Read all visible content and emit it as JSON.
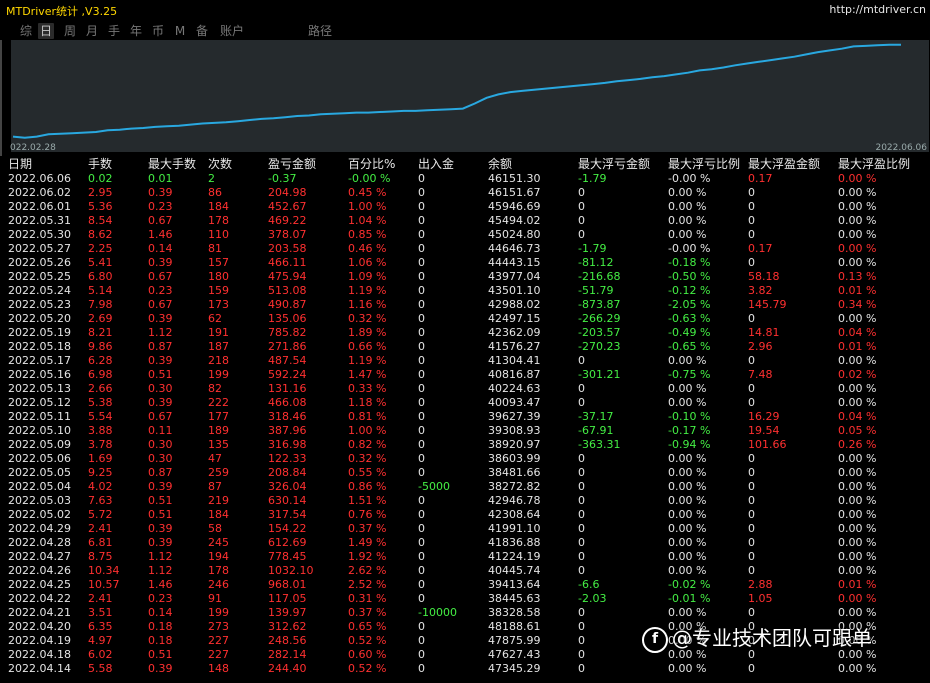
{
  "app": {
    "title": "MTDriver统计 ,V3.25",
    "url": "http://mtdriver.cn"
  },
  "menu": [
    {
      "label": "综",
      "active": false
    },
    {
      "label": "日",
      "active": true
    },
    {
      "label": "周",
      "active": false
    },
    {
      "label": "月",
      "active": false
    },
    {
      "label": "手",
      "active": false
    },
    {
      "label": "年",
      "active": false
    },
    {
      "label": "币",
      "active": false
    },
    {
      "label": "M",
      "active": false
    },
    {
      "label": "备",
      "active": false
    },
    {
      "label": "账户",
      "active": false
    },
    {
      "label": "路径",
      "active": false
    }
  ],
  "chart": {
    "start_date": "022.02.28",
    "end_date": "2022.06.06",
    "line_color": "#29a8e0"
  },
  "chart_data": {
    "type": "line",
    "series": [
      {
        "values": [
          38100,
          38000,
          38100,
          38300,
          38350,
          38400,
          38450,
          38500,
          38650,
          38700,
          38800,
          38850,
          38950,
          39000,
          39050,
          39150,
          39250,
          39300,
          39350,
          39450,
          39550,
          39650,
          39700,
          39800,
          39900,
          39950,
          40050,
          40100,
          40150,
          40200,
          40200,
          40250,
          40300,
          40350,
          40350,
          40400,
          40450,
          40500,
          40550,
          41000,
          41500,
          41800,
          42000,
          42100,
          42200,
          42300,
          42400,
          42500,
          42600,
          42700,
          42800,
          42950,
          43050,
          43150,
          43300,
          43400,
          43550,
          43700,
          43900,
          44000,
          44150,
          44350,
          44500,
          44650,
          44800,
          44950,
          45100,
          45300,
          45500,
          45650,
          45800,
          46000,
          46050,
          46100,
          46150,
          46152
        ]
      }
    ],
    "ylim": [
      37800,
      46300
    ],
    "grid": false
  },
  "table": {
    "headers": [
      "日期",
      "手数",
      "最大手数",
      "次数",
      "盈亏金额",
      "百分比%",
      "出入金",
      "余额",
      "最大浮亏金额",
      "最大浮亏比例",
      "最大浮盈金额",
      "最大浮盈比例"
    ],
    "rows": [
      [
        "2022.06.06",
        "0.02",
        "0.01",
        "2",
        "-0.37",
        "-0.00 %",
        "0",
        "46151.30",
        "-1.79",
        "-0.00 %",
        "0.17",
        "0.00 %"
      ],
      [
        "2022.06.02",
        "2.95",
        "0.39",
        "86",
        "204.98",
        "0.45 %",
        "0",
        "46151.67",
        "0",
        "0.00 %",
        "0",
        "0.00 %"
      ],
      [
        "2022.06.01",
        "5.36",
        "0.23",
        "184",
        "452.67",
        "1.00 %",
        "0",
        "45946.69",
        "0",
        "0.00 %",
        "0",
        "0.00 %"
      ],
      [
        "2022.05.31",
        "8.54",
        "0.67",
        "178",
        "469.22",
        "1.04 %",
        "0",
        "45494.02",
        "0",
        "0.00 %",
        "0",
        "0.00 %"
      ],
      [
        "2022.05.30",
        "8.62",
        "1.46",
        "110",
        "378.07",
        "0.85 %",
        "0",
        "45024.80",
        "0",
        "0.00 %",
        "0",
        "0.00 %"
      ],
      [
        "2022.05.27",
        "2.25",
        "0.14",
        "81",
        "203.58",
        "0.46 %",
        "0",
        "44646.73",
        "-1.79",
        "-0.00 %",
        "0.17",
        "0.00 %"
      ],
      [
        "2022.05.26",
        "5.41",
        "0.39",
        "157",
        "466.11",
        "1.06 %",
        "0",
        "44443.15",
        "-81.12",
        "-0.18 %",
        "0",
        "0.00 %"
      ],
      [
        "2022.05.25",
        "6.80",
        "0.67",
        "180",
        "475.94",
        "1.09 %",
        "0",
        "43977.04",
        "-216.68",
        "-0.50 %",
        "58.18",
        "0.13 %"
      ],
      [
        "2022.05.24",
        "5.14",
        "0.23",
        "159",
        "513.08",
        "1.19 %",
        "0",
        "43501.10",
        "-51.79",
        "-0.12 %",
        "3.82",
        "0.01 %"
      ],
      [
        "2022.05.23",
        "7.98",
        "0.67",
        "173",
        "490.87",
        "1.16 %",
        "0",
        "42988.02",
        "-873.87",
        "-2.05 %",
        "145.79",
        "0.34 %"
      ],
      [
        "2022.05.20",
        "2.69",
        "0.39",
        "62",
        "135.06",
        "0.32 %",
        "0",
        "42497.15",
        "-266.29",
        "-0.63 %",
        "0",
        "0.00 %"
      ],
      [
        "2022.05.19",
        "8.21",
        "1.12",
        "191",
        "785.82",
        "1.89 %",
        "0",
        "42362.09",
        "-203.57",
        "-0.49 %",
        "14.81",
        "0.04 %"
      ],
      [
        "2022.05.18",
        "9.86",
        "0.87",
        "187",
        "271.86",
        "0.66 %",
        "0",
        "41576.27",
        "-270.23",
        "-0.65 %",
        "2.96",
        "0.01 %"
      ],
      [
        "2022.05.17",
        "6.28",
        "0.39",
        "218",
        "487.54",
        "1.19 %",
        "0",
        "41304.41",
        "0",
        "0.00 %",
        "0",
        "0.00 %"
      ],
      [
        "2022.05.16",
        "6.98",
        "0.51",
        "199",
        "592.24",
        "1.47 %",
        "0",
        "40816.87",
        "-301.21",
        "-0.75 %",
        "7.48",
        "0.02 %"
      ],
      [
        "2022.05.13",
        "2.66",
        "0.30",
        "82",
        "131.16",
        "0.33 %",
        "0",
        "40224.63",
        "0",
        "0.00 %",
        "0",
        "0.00 %"
      ],
      [
        "2022.05.12",
        "5.38",
        "0.39",
        "222",
        "466.08",
        "1.18 %",
        "0",
        "40093.47",
        "0",
        "0.00 %",
        "0",
        "0.00 %"
      ],
      [
        "2022.05.11",
        "5.54",
        "0.67",
        "177",
        "318.46",
        "0.81 %",
        "0",
        "39627.39",
        "-37.17",
        "-0.10 %",
        "16.29",
        "0.04 %"
      ],
      [
        "2022.05.10",
        "3.88",
        "0.11",
        "189",
        "387.96",
        "1.00 %",
        "0",
        "39308.93",
        "-67.91",
        "-0.17 %",
        "19.54",
        "0.05 %"
      ],
      [
        "2022.05.09",
        "3.78",
        "0.30",
        "135",
        "316.98",
        "0.82 %",
        "0",
        "38920.97",
        "-363.31",
        "-0.94 %",
        "101.66",
        "0.26 %"
      ],
      [
        "2022.05.06",
        "1.69",
        "0.30",
        "47",
        "122.33",
        "0.32 %",
        "0",
        "38603.99",
        "0",
        "0.00 %",
        "0",
        "0.00 %"
      ],
      [
        "2022.05.05",
        "9.25",
        "0.87",
        "259",
        "208.84",
        "0.55 %",
        "0",
        "38481.66",
        "0",
        "0.00 %",
        "0",
        "0.00 %"
      ],
      [
        "2022.05.04",
        "4.02",
        "0.39",
        "87",
        "326.04",
        "0.86 %",
        "-5000",
        "38272.82",
        "0",
        "0.00 %",
        "0",
        "0.00 %"
      ],
      [
        "2022.05.03",
        "7.63",
        "0.51",
        "219",
        "630.14",
        "1.51 %",
        "0",
        "42946.78",
        "0",
        "0.00 %",
        "0",
        "0.00 %"
      ],
      [
        "2022.05.02",
        "5.72",
        "0.51",
        "184",
        "317.54",
        "0.76 %",
        "0",
        "42308.64",
        "0",
        "0.00 %",
        "0",
        "0.00 %"
      ],
      [
        "2022.04.29",
        "2.41",
        "0.39",
        "58",
        "154.22",
        "0.37 %",
        "0",
        "41991.10",
        "0",
        "0.00 %",
        "0",
        "0.00 %"
      ],
      [
        "2022.04.28",
        "6.81",
        "0.39",
        "245",
        "612.69",
        "1.49 %",
        "0",
        "41836.88",
        "0",
        "0.00 %",
        "0",
        "0.00 %"
      ],
      [
        "2022.04.27",
        "8.75",
        "1.12",
        "194",
        "778.45",
        "1.92 %",
        "0",
        "41224.19",
        "0",
        "0.00 %",
        "0",
        "0.00 %"
      ],
      [
        "2022.04.26",
        "10.34",
        "1.12",
        "178",
        "1032.10",
        "2.62 %",
        "0",
        "40445.74",
        "0",
        "0.00 %",
        "0",
        "0.00 %"
      ],
      [
        "2022.04.25",
        "10.57",
        "1.46",
        "246",
        "968.01",
        "2.52 %",
        "0",
        "39413.64",
        "-6.6",
        "-0.02 %",
        "2.88",
        "0.01 %"
      ],
      [
        "2022.04.22",
        "2.41",
        "0.23",
        "91",
        "117.05",
        "0.31 %",
        "0",
        "38445.63",
        "-2.03",
        "-0.01 %",
        "1.05",
        "0.00 %"
      ],
      [
        "2022.04.21",
        "3.51",
        "0.14",
        "199",
        "139.97",
        "0.37 %",
        "-10000",
        "38328.58",
        "0",
        "0.00 %",
        "0",
        "0.00 %"
      ],
      [
        "2022.04.20",
        "6.35",
        "0.18",
        "273",
        "312.62",
        "0.65 %",
        "0",
        "48188.61",
        "0",
        "0.00 %",
        "0",
        "0.00 %"
      ],
      [
        "2022.04.19",
        "4.97",
        "0.18",
        "227",
        "248.56",
        "0.52 %",
        "0",
        "47875.99",
        "0",
        "0.00 %",
        "0",
        "0.00 %"
      ],
      [
        "2022.04.18",
        "6.02",
        "0.51",
        "227",
        "282.14",
        "0.60 %",
        "0",
        "47627.43",
        "0",
        "0.00 %",
        "0",
        "0.00 %"
      ],
      [
        "2022.04.14",
        "5.58",
        "0.39",
        "148",
        "244.40",
        "0.52 %",
        "0",
        "47345.29",
        "0",
        "0.00 %",
        "0",
        "0.00 %"
      ]
    ]
  },
  "watermark": {
    "icon": "f",
    "text": "@专业技术团队可跟单"
  }
}
